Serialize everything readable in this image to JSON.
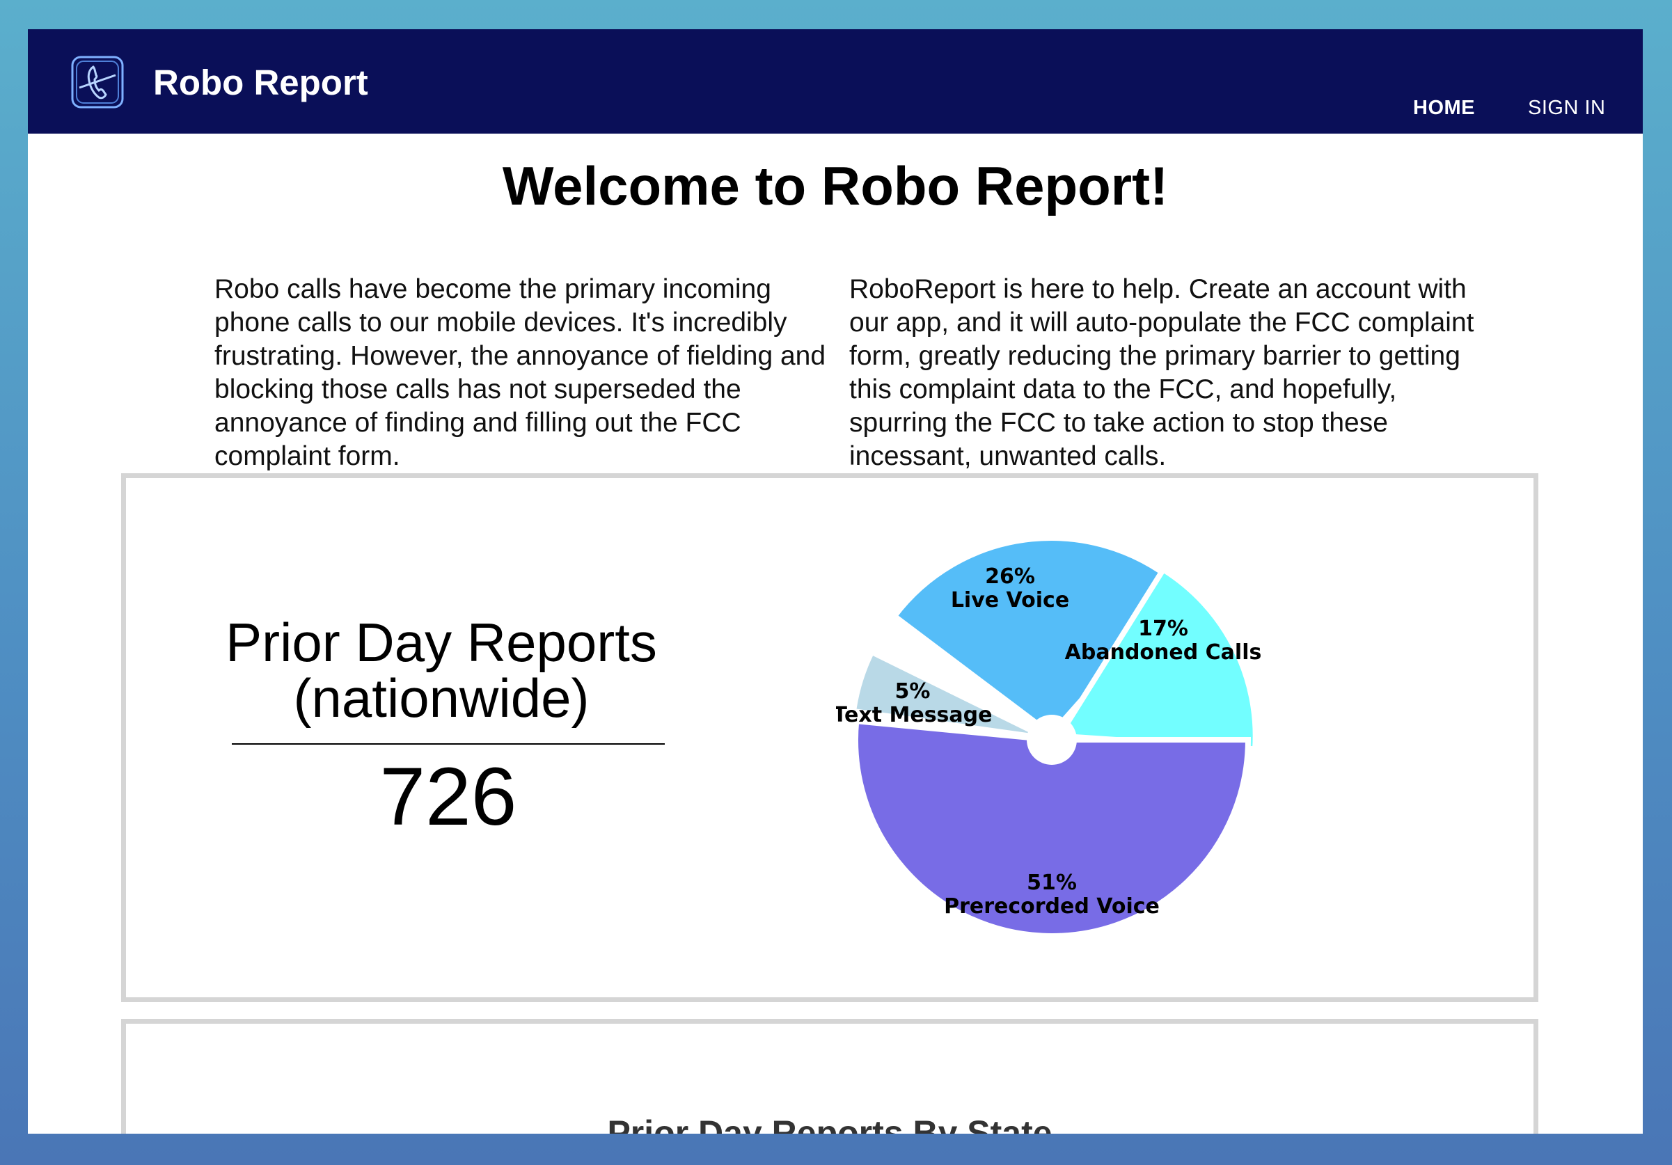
{
  "app": {
    "title": "Robo Report"
  },
  "nav": {
    "home": "HOME",
    "sign_in": "SIGN IN"
  },
  "main": {
    "heading": "Welcome to Robo Report!",
    "intro_left": "Robo calls have become the primary incoming phone calls to our mobile devices. It's incredibly frustrating. However, the annoyance of fielding and blocking those calls has not superseded the annoyance of finding and filling out the FCC complaint form.",
    "intro_right": "RoboReport is here to help. Create an account with our app, and it will auto-populate the FCC complaint form, greatly reducing the primary barrier to getting this complaint data to the FCC, and hopefully, spurring the FCC to take action to stop these incessant, unwanted calls."
  },
  "reports": {
    "title_line1": "Prior Day Reports",
    "title_line2": "(nationwide)",
    "count": "726"
  },
  "chart_data": {
    "type": "pie",
    "slices": [
      {
        "name": "Live Voice",
        "percent": 26,
        "label": "26%",
        "color": "#55bdf8"
      },
      {
        "name": "Abandoned Calls",
        "percent": 17,
        "label": "17%",
        "color": "#72feff"
      },
      {
        "name": "Prerecorded Voice",
        "percent": 51,
        "label": "51%",
        "color": "#786ce6"
      },
      {
        "name": "Text Message",
        "percent": 5,
        "label": "5%",
        "color": "#b9d9e7"
      }
    ]
  },
  "state_section": {
    "title": "Prior Day Reports By State"
  }
}
